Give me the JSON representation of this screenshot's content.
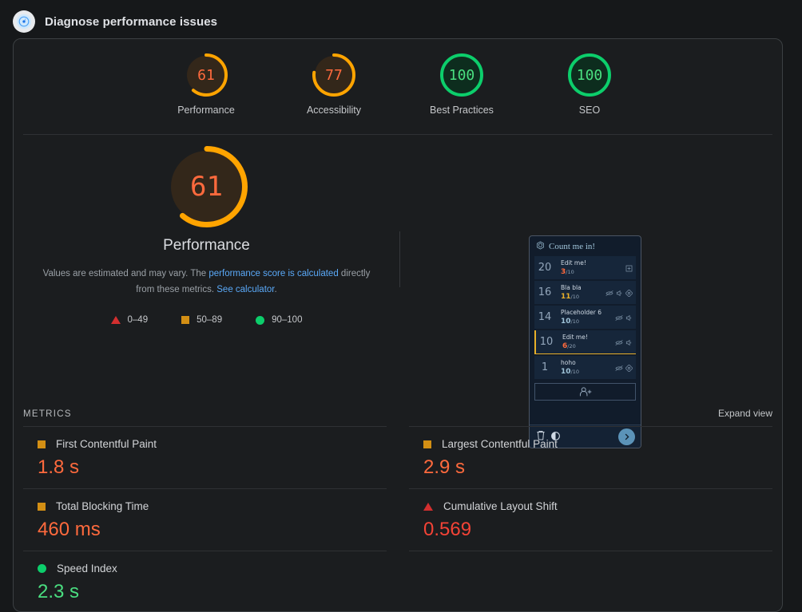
{
  "header": {
    "title": "Diagnose performance issues",
    "logo_icon": "lighthouse-icon"
  },
  "colors": {
    "orange": "#ffa400",
    "orange_text": "#ff6a3d",
    "green": "#0cce6b",
    "green_text": "#4ade80",
    "red": "#f44336",
    "red_swatch": "#d32f2f",
    "amber_swatch": "#d38f14",
    "link": "#5aa9f8"
  },
  "score_gauges": [
    {
      "label": "Performance",
      "value": "61",
      "score": 61,
      "color": "#ffa400",
      "text_color": "#ff6a3d"
    },
    {
      "label": "Accessibility",
      "value": "77",
      "score": 77,
      "color": "#ffa400",
      "text_color": "#ff6a3d"
    },
    {
      "label": "Best Practices",
      "value": "100",
      "score": 100,
      "color": "#0cce6b",
      "text_color": "#4ade80"
    },
    {
      "label": "SEO",
      "value": "100",
      "score": 100,
      "color": "#0cce6b",
      "text_color": "#4ade80"
    }
  ],
  "performance_detail": {
    "gauge_value": "61",
    "gauge_score": 61,
    "gauge_label": "Performance",
    "disclaimer_pre": "Values are estimated and may vary. The ",
    "disclaimer_link1": "performance score is calculated",
    "disclaimer_mid": " directly from these metrics. ",
    "disclaimer_link2": "See calculator",
    "disclaimer_post": ".",
    "legend": [
      {
        "shape": "triangle",
        "label": "0–49"
      },
      {
        "shape": "square",
        "label": "50–89"
      },
      {
        "shape": "circle",
        "label": "90–100"
      }
    ]
  },
  "screenshot": {
    "title": "Count me in!",
    "title_icon": "d20-dice-icon",
    "rows": [
      {
        "num": "20",
        "name": "Edit me!",
        "score": "3",
        "den": "/10",
        "score_color": "#ff6a3d",
        "icons": [
          "plus-box-icon"
        ]
      },
      {
        "num": "16",
        "name": "Bla bla",
        "score": "11",
        "den": "/10",
        "score_color": "#e8b02a",
        "icons": [
          "eye-off-icon",
          "volume-icon",
          "diamond-icon"
        ]
      },
      {
        "num": "14",
        "name": "Placeholder 6",
        "score": "10",
        "den": "/10",
        "score_color": "#9fc3d8",
        "icons": [
          "eye-off-icon",
          "volume-icon"
        ]
      },
      {
        "num": "10",
        "name": "Edit me!",
        "score": "6",
        "den": "/20",
        "score_color": "#ff6a3d",
        "icons": [
          "eye-off-icon",
          "volume-icon"
        ],
        "selected": true
      },
      {
        "num": "1",
        "name": "hoho",
        "score": "10",
        "den": "/10",
        "score_color": "#9fc3d8",
        "icons": [
          "eye-off-icon",
          "diamond-icon"
        ]
      }
    ],
    "add_button_icon": "add-person-icon",
    "bottom": {
      "trash_icon": "trash-icon",
      "contrast_icon": "contrast-toggle-icon",
      "next_icon": "chevron-right-icon"
    }
  },
  "metrics_section": {
    "title": "METRICS",
    "expand_view": "Expand view",
    "items": [
      {
        "name": "First Contentful Paint",
        "value": "1.8 s",
        "shape": "square",
        "color": "#ff6a3d"
      },
      {
        "name": "Largest Contentful Paint",
        "value": "2.9 s",
        "shape": "square",
        "color": "#ff6a3d"
      },
      {
        "name": "Total Blocking Time",
        "value": "460 ms",
        "shape": "square",
        "color": "#ff6a3d"
      },
      {
        "name": "Cumulative Layout Shift",
        "value": "0.569",
        "shape": "triangle",
        "color": "#f44336"
      },
      {
        "name": "Speed Index",
        "value": "2.3 s",
        "shape": "circle",
        "color": "#4ade80"
      }
    ]
  }
}
